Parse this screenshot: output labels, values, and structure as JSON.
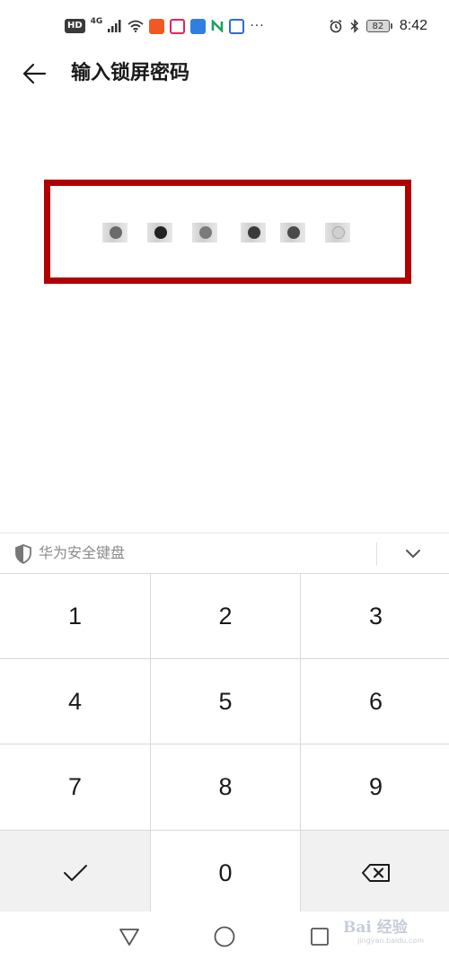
{
  "status_bar": {
    "hd": "HD",
    "network": "4G",
    "more": "···",
    "battery": "82",
    "time": "8:42",
    "icons": [
      "signal-icon",
      "wifi-icon",
      "app-icon-orange",
      "app-icon-red",
      "app-icon-blue",
      "app-icon-green",
      "app-icon-blue-2",
      "alarm-icon",
      "bluetooth-icon"
    ]
  },
  "header": {
    "title": "输入锁屏密码",
    "back_icon": "arrow-left-icon"
  },
  "pin": {
    "entered": 6,
    "highlight_color": "#b00000"
  },
  "keyboard": {
    "title": "华为安全键盘",
    "shield_icon": "shield-icon",
    "collapse_icon": "chevron-down-icon",
    "keys": {
      "k1": "1",
      "k2": "2",
      "k3": "3",
      "k4": "4",
      "k5": "5",
      "k6": "6",
      "k7": "7",
      "k8": "8",
      "k9": "9",
      "k0": "0"
    },
    "confirm_icon": "check-icon",
    "delete_icon": "backspace-icon"
  },
  "nav_bar": {
    "back_icon": "triangle-back-icon",
    "home_icon": "circle-home-icon",
    "recents_icon": "square-recents-icon"
  },
  "watermark": {
    "logo": "Bai 经验",
    "url": "jingyan.baidu.com"
  }
}
